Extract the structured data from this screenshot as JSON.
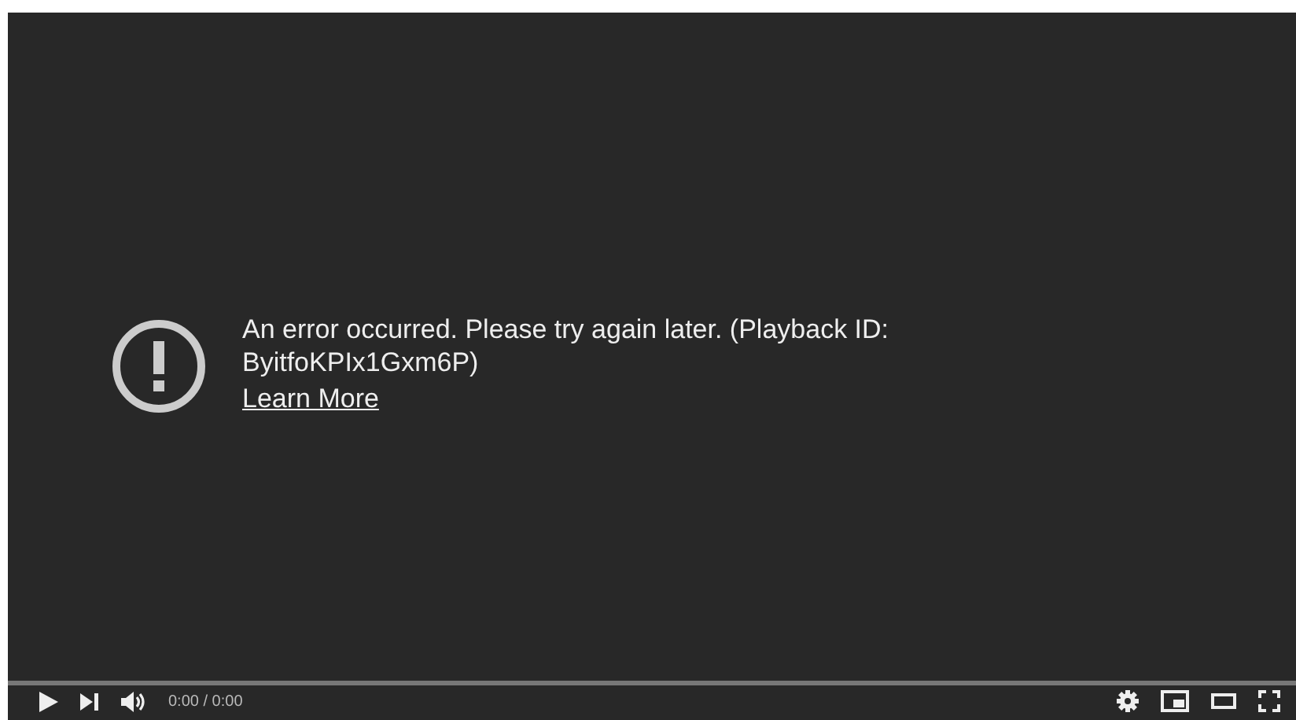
{
  "error": {
    "message": "An error occurred. Please try again later. (Playback ID: ByitfoKPIx1Gxm6P)",
    "link": "Learn More"
  },
  "controls": {
    "time": "0:00 / 0:00"
  }
}
